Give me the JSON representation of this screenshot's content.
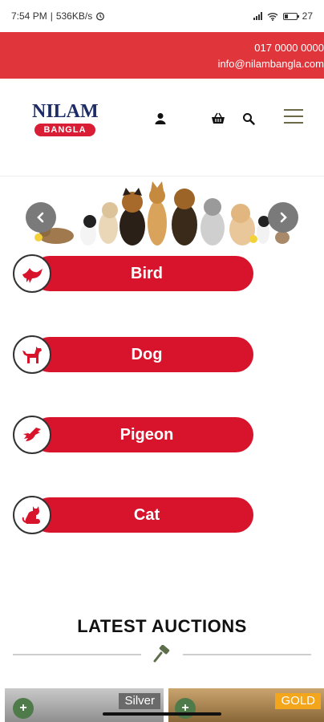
{
  "status_bar": {
    "time": "7:54 PM",
    "net_speed": "536KB/s",
    "battery": "27"
  },
  "topbar": {
    "phone": "017 0000 0000",
    "email": "info@nilambangla.com",
    "color": "#e0353b"
  },
  "header": {
    "logo_top": "NILAM",
    "logo_bottom": "BANGLA",
    "icons": [
      "user-icon",
      "basket-icon",
      "search-icon",
      "menu-icon"
    ]
  },
  "banner": {
    "prev_icon": "chevron-left-icon",
    "next_icon": "chevron-right-icon"
  },
  "categories": [
    {
      "label": "Bird",
      "icon": "bird-icon"
    },
    {
      "label": "Dog",
      "icon": "dog-icon"
    },
    {
      "label": "Pigeon",
      "icon": "pigeon-icon"
    },
    {
      "label": "Cat",
      "icon": "cat-icon"
    }
  ],
  "accent": "#d8132c",
  "latest": {
    "title": "LATEST AUCTIONS",
    "icon": "gavel-icon",
    "cards": [
      {
        "badge": "Silver",
        "badge_color": "#6a6a6a"
      },
      {
        "badge": "GOLD",
        "badge_color": "#f3a51c"
      }
    ]
  }
}
